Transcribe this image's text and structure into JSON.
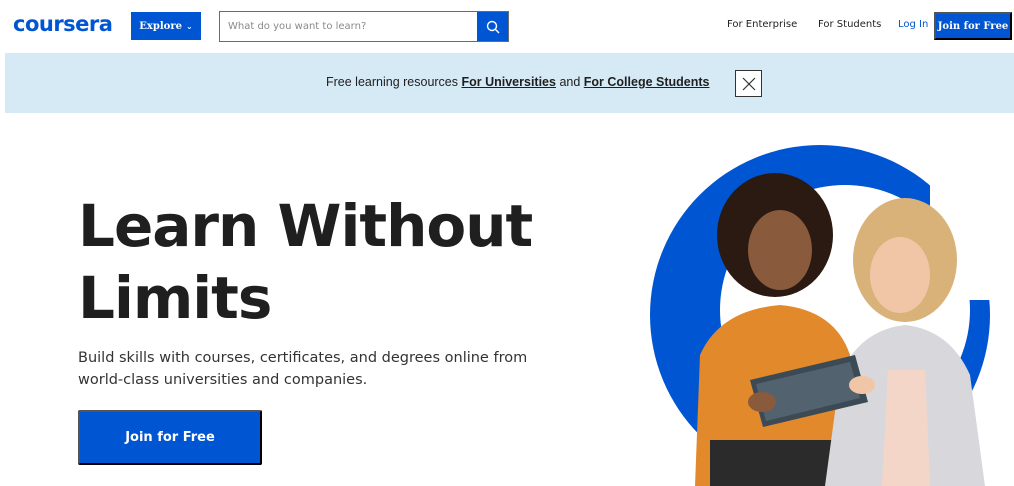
{
  "header": {
    "logo_text": "coursera",
    "explore_label": "Explore",
    "search_placeholder": "What do you want to learn?",
    "links": {
      "enterprise": "For Enterprise",
      "students": "For Students",
      "login": "Log In"
    },
    "join_label": "Join for Free"
  },
  "banner": {
    "prefix": "Free learning resources ",
    "link1": "For Universities",
    "middle": " and ",
    "link2": "For College Students"
  },
  "hero": {
    "title_line1": "Learn Without",
    "title_line2": "Limits",
    "subtitle": "Build skills with courses, certificates, and degrees online from world-class universities and companies.",
    "cta_label": "Join for Free"
  },
  "colors": {
    "brand": "#0056d2",
    "banner_bg": "#d5eaf5"
  },
  "icons": {
    "search": "search-icon",
    "close": "close-icon",
    "chevron": "chevron-down-icon"
  }
}
